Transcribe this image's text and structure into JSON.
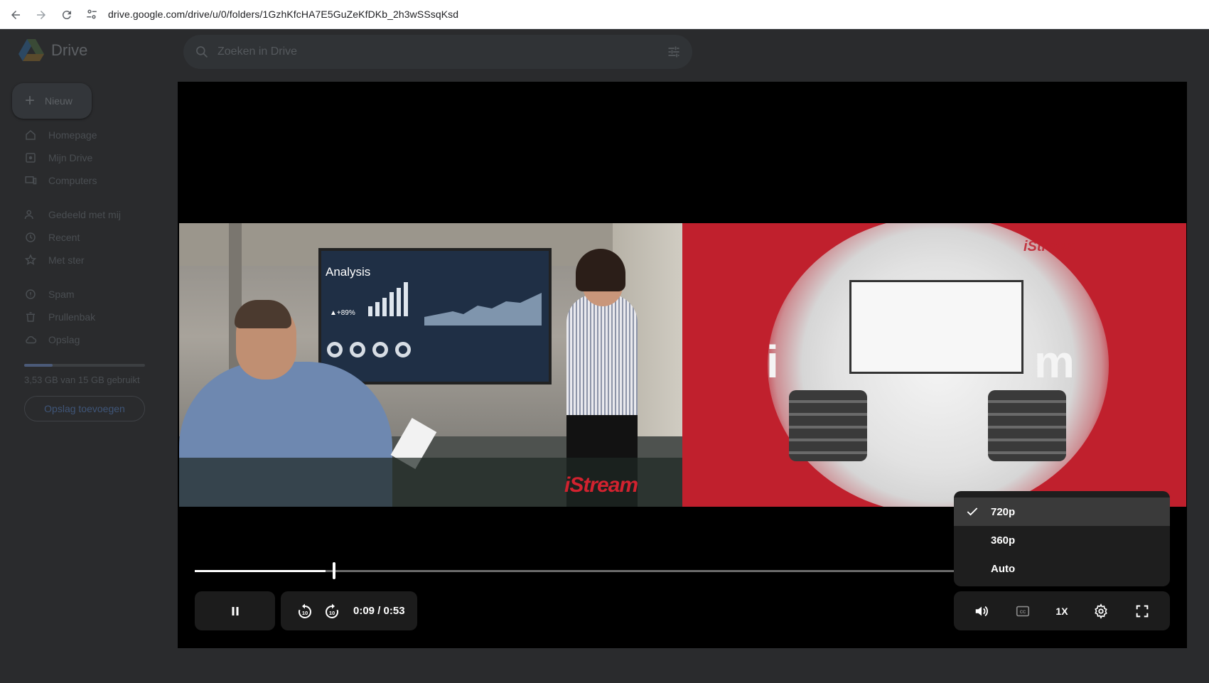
{
  "browser": {
    "url": "drive.google.com/drive/u/0/folders/1GzhKfcHA7E5GuZeKfDKb_2h3wSSsqKsd",
    "back_icon": "arrow-left-icon",
    "forward_icon": "arrow-right-icon",
    "reload_icon": "reload-icon",
    "site_info_icon": "tune-icon"
  },
  "drive": {
    "app_name": "Drive",
    "search_placeholder": "Zoeken in Drive",
    "new_button": "Nieuw",
    "nav": [
      {
        "label": "Homepage",
        "icon": "home-icon"
      },
      {
        "label": "Mijn Drive",
        "icon": "drive-icon"
      },
      {
        "label": "Computers",
        "icon": "computer-icon"
      },
      {
        "label": "Gedeeld met mij",
        "icon": "people-icon"
      },
      {
        "label": "Recent",
        "icon": "clock-icon"
      },
      {
        "label": "Met ster",
        "icon": "star-icon"
      },
      {
        "label": "Spam",
        "icon": "spam-icon"
      },
      {
        "label": "Prullenbak",
        "icon": "trash-icon"
      },
      {
        "label": "Opslag",
        "icon": "cloud-icon"
      }
    ],
    "storage_text": "3,53 GB van 15 GB gebruikt",
    "storage_fraction": 0.235,
    "storage_button": "Opslag toevoegen"
  },
  "player": {
    "current_time": "0:09",
    "separator": "/",
    "duration": "0:53",
    "progress_fraction": 0.17,
    "speed_label": "1X",
    "quality_options": [
      {
        "label": "720p",
        "selected": true
      },
      {
        "label": "360p",
        "selected": false
      },
      {
        "label": "Auto",
        "selected": false
      }
    ],
    "screen_title": "Analysis",
    "screen_stat": "▲+89%",
    "watermark_left": "iStream",
    "watermark_right": "iStream",
    "colors": {
      "brand_red": "#c0202d",
      "control_bg": "#1c1c1c",
      "menu_bg": "#1e1e1e"
    }
  }
}
